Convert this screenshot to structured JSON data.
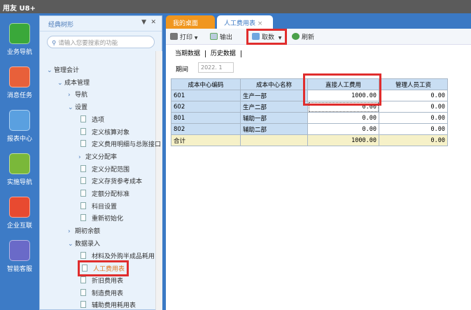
{
  "app": {
    "title": "用友 U8+"
  },
  "leftnav": [
    {
      "label": "业务导航",
      "icon": "business-nav-icon",
      "color": "#3aa83a"
    },
    {
      "label": "消息任务",
      "icon": "message-task-icon",
      "color": "#e8603a"
    },
    {
      "label": "报表中心",
      "icon": "report-center-icon",
      "color": "#5aa0e0"
    },
    {
      "label": "实施导航",
      "icon": "implementation-nav-icon",
      "color": "#7ab83a"
    },
    {
      "label": "企业互联",
      "icon": "enterprise-connect-icon",
      "color": "#e84a30"
    },
    {
      "label": "智能客服",
      "icon": "smart-service-icon",
      "color": "#6a6ac8"
    }
  ],
  "tree": {
    "title": "经典树形",
    "search_placeholder": "请输入您要搜索的功能",
    "items": [
      {
        "label": "管理会计",
        "type": "open",
        "level": 0
      },
      {
        "label": "成本管理",
        "type": "open",
        "level": 1
      },
      {
        "label": "导航",
        "type": "closed",
        "level": 2
      },
      {
        "label": "设置",
        "type": "open",
        "level": 2
      },
      {
        "label": "选项",
        "type": "doc",
        "level": 3
      },
      {
        "label": "定义核算对象",
        "type": "doc",
        "level": 3
      },
      {
        "label": "定义费用明细与总账接口",
        "type": "doc",
        "level": 3
      },
      {
        "label": "定义分配率",
        "type": "closed",
        "level": 3
      },
      {
        "label": "定义分配范围",
        "type": "doc",
        "level": 3
      },
      {
        "label": "定义存货参考成本",
        "type": "doc",
        "level": 3
      },
      {
        "label": "定额分配标准",
        "type": "doc",
        "level": 3
      },
      {
        "label": "科目设置",
        "type": "doc",
        "level": 3
      },
      {
        "label": "重新初始化",
        "type": "doc",
        "level": 3
      },
      {
        "label": "期初余额",
        "type": "closed",
        "level": 2
      },
      {
        "label": "数据录入",
        "type": "open",
        "level": 2
      },
      {
        "label": "材料及外购半成品耗用",
        "type": "doc",
        "level": 3
      },
      {
        "label": "人工费用表",
        "type": "doc",
        "level": 3,
        "selected": true
      },
      {
        "label": "折旧费用表",
        "type": "doc",
        "level": 3
      },
      {
        "label": "制造费用表",
        "type": "doc",
        "level": 3
      },
      {
        "label": "辅助费用耗用表",
        "type": "doc",
        "level": 3
      }
    ]
  },
  "tabs": [
    {
      "label": "我的桌面"
    },
    {
      "label": "人工费用表",
      "active": true
    }
  ],
  "toolbar": {
    "print": "打印",
    "export": "输出",
    "fetch": "取数",
    "refresh": "刷新"
  },
  "subtabs": [
    "当期数据",
    "历史数据"
  ],
  "period": {
    "label": "期间",
    "value": "2022. 1"
  },
  "table": {
    "headers": [
      "成本中心编码",
      "成本中心名称",
      "直接人工费用",
      "管理人员工资"
    ],
    "rows": [
      [
        "601",
        "生产一部",
        "1000.00",
        "0.00"
      ],
      [
        "602",
        "生产二部",
        "0.00",
        "0.00"
      ],
      [
        "801",
        "辅助一部",
        "0.00",
        "0.00"
      ],
      [
        "802",
        "辅助二部",
        "0.00",
        "0.00"
      ]
    ],
    "total": [
      "合计",
      "",
      "1000.00",
      "0.00"
    ]
  }
}
